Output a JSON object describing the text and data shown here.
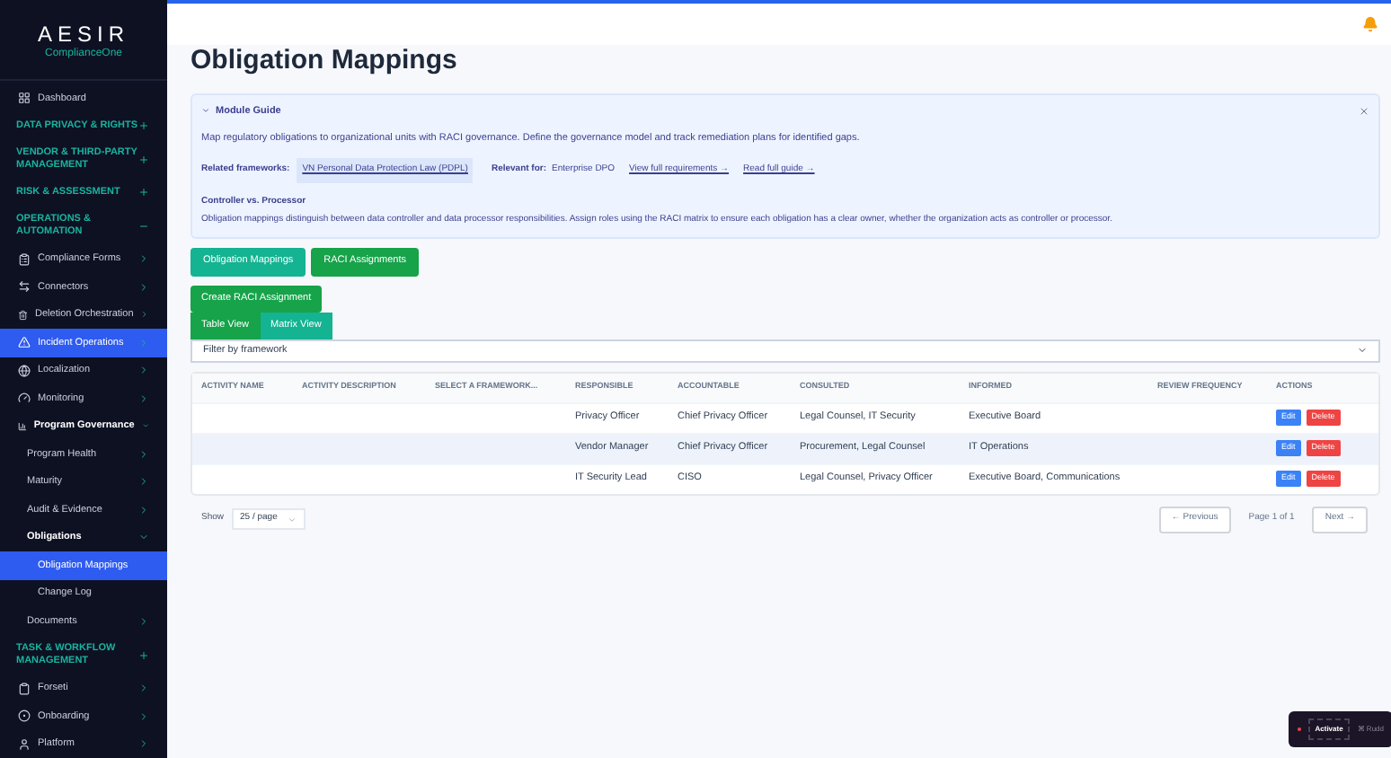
{
  "sidebar": {
    "logo": {
      "name": "AESIR",
      "tagline": "ComplianceOne"
    },
    "items": [
      {
        "kind": "link",
        "label": "Dashboard",
        "selected": false
      },
      {
        "kind": "section",
        "label": "DATA PRIVACY & RIGHTS",
        "expanded": false
      },
      {
        "kind": "section",
        "label": "VENDOR & THIRD-PARTY MANAGEMENT",
        "expanded": false
      },
      {
        "kind": "section",
        "label": "RISK & ASSESSMENT",
        "expanded": false
      },
      {
        "kind": "section",
        "label": "OPERATIONS & AUTOMATION",
        "expanded": true,
        "children": [
          {
            "kind": "menu",
            "label": "Compliance Forms",
            "selected": false
          },
          {
            "kind": "menu",
            "label": "Connectors",
            "selected": false
          },
          {
            "kind": "menu",
            "label": "Deletion Orchestration",
            "selected": false
          },
          {
            "kind": "menu",
            "label": "Incident Operations",
            "selected": true
          },
          {
            "kind": "menu",
            "label": "Localization",
            "selected": false
          },
          {
            "kind": "menu",
            "label": "Monitoring",
            "selected": false
          },
          {
            "kind": "menu",
            "label": "Program Governance",
            "selected": false,
            "expanded": true,
            "children": [
              {
                "kind": "menu",
                "label": "Program Health",
                "selected": false
              },
              {
                "kind": "menu",
                "label": "Maturity",
                "selected": false
              },
              {
                "kind": "menu",
                "label": "Audit & Evidence",
                "selected": false
              },
              {
                "kind": "menu",
                "label": "Obligations",
                "selected": false,
                "expanded": true,
                "children": [
                  {
                    "kind": "link",
                    "label": "Obligation Mappings",
                    "selected": true
                  },
                  {
                    "kind": "link",
                    "label": "Change Log",
                    "selected": false
                  }
                ]
              },
              {
                "kind": "menu",
                "label": "Documents",
                "selected": false
              }
            ]
          }
        ]
      },
      {
        "kind": "section",
        "label": "TASK & WORKFLOW MANAGEMENT",
        "expanded": false
      },
      {
        "kind": "menu",
        "label": "Forseti",
        "selected": false
      },
      {
        "kind": "menu",
        "label": "Onboarding",
        "selected": false
      },
      {
        "kind": "menu",
        "label": "Platform",
        "selected": false
      }
    ]
  },
  "page": {
    "title": "Obligation Mappings"
  },
  "guide": {
    "title": "Module Guide",
    "expanded": true,
    "description": "Map regulatory obligations to organizational units with RACI governance. Define the governance model and track remediation plans for identified gaps.",
    "frameworks_label": "Related frameworks:",
    "framework": "VN Personal Data Protection Law (PDPL)",
    "relevant_label": "Relevant for:",
    "relevant": "Enterprise DPO",
    "links": [
      "View full requirements →",
      "Read full guide →"
    ],
    "note_title": "Controller vs. Processor",
    "note": "Obligation mappings distinguish between data controller and data processor responsibilities. Assign roles using the RACI matrix to ensure each obligation has a clear owner, whether the organization acts as controller or processor."
  },
  "tabs": [
    {
      "label": "Obligation Mappings",
      "selected": false
    },
    {
      "label": "RACI Assignments",
      "selected": true
    }
  ],
  "create_button": "Create RACI Assignment",
  "view_tabs": [
    {
      "label": "Table View",
      "selected": true
    },
    {
      "label": "Matrix View",
      "selected": false
    }
  ],
  "filter": {
    "value": "Filter by framework"
  },
  "table": {
    "columns": [
      "ACTIVITY NAME",
      "ACTIVITY DESCRIPTION",
      "SELECT A FRAMEWORK...",
      "RESPONSIBLE",
      "ACCOUNTABLE",
      "CONSULTED",
      "INFORMED",
      "REVIEW FREQUENCY",
      "ACTIONS"
    ],
    "rows": [
      {
        "responsible": "Privacy Officer",
        "accountable": "Chief Privacy Officer",
        "consulted": "Legal Counsel, IT Security",
        "informed": "Executive Board",
        "actions": [
          "Edit",
          "Delete"
        ]
      },
      {
        "responsible": "Vendor Manager",
        "accountable": "Chief Privacy Officer",
        "consulted": "Procurement, Legal Counsel",
        "informed": "IT Operations",
        "actions": [
          "Edit",
          "Delete"
        ]
      },
      {
        "responsible": "IT Security Lead",
        "accountable": "CISO",
        "consulted": "Legal Counsel, Privacy Officer",
        "informed": "Executive Board, Communications",
        "actions": [
          "Edit",
          "Delete"
        ]
      }
    ]
  },
  "pagination": {
    "show_label": "Show",
    "page_size": "25 / page",
    "previous": "← Previous",
    "page": "Page 1 of 1",
    "next": "Next →"
  },
  "widget": {
    "button": "Activate",
    "hint": "⌘ Rudd"
  }
}
